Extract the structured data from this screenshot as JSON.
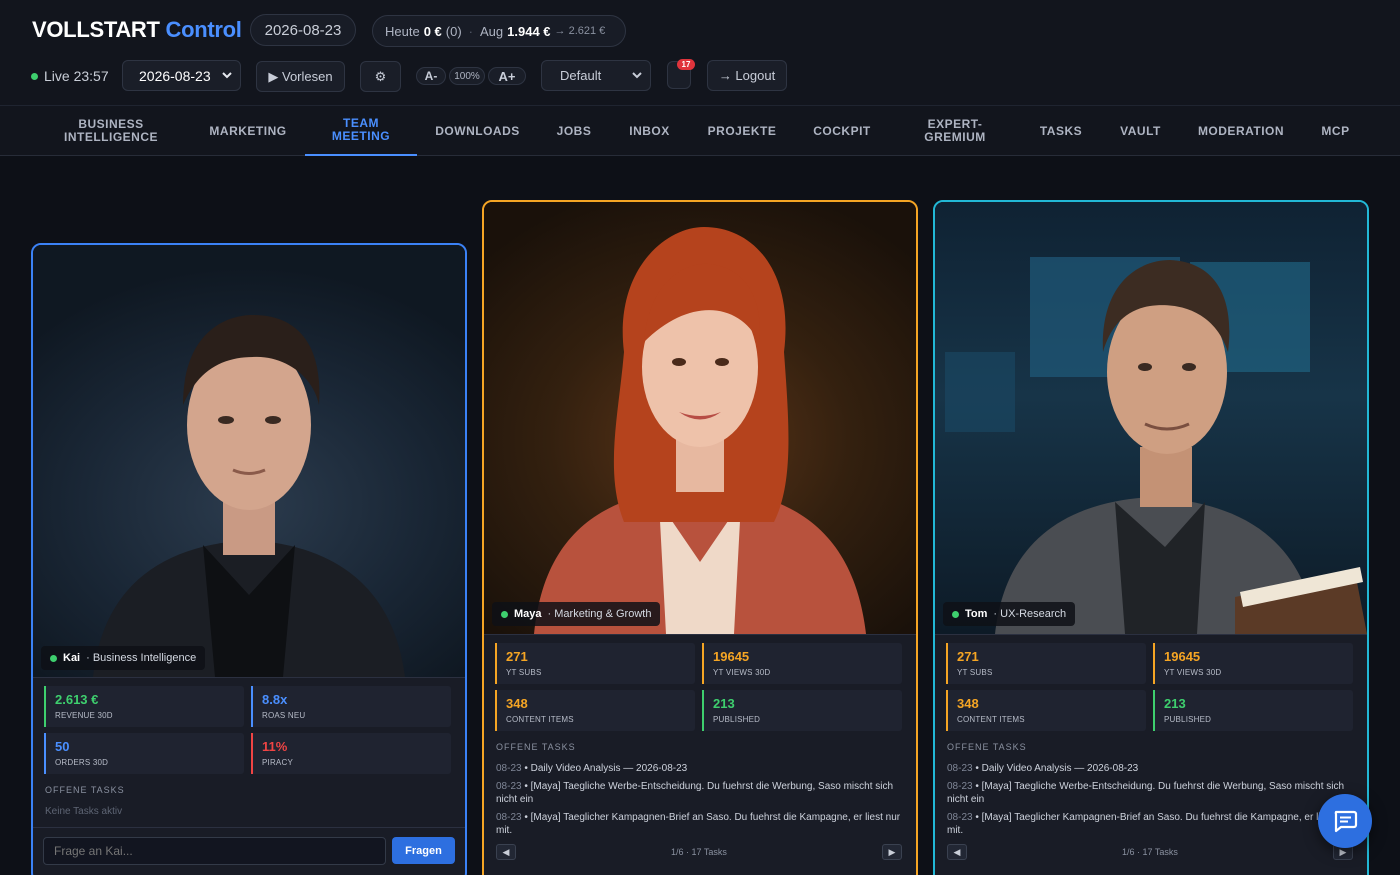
{
  "header": {
    "brand_main": "VOLLSTART",
    "brand_accent": "Control",
    "date_pill": "2026-08-23",
    "stats_pill": {
      "today_label": "Heute",
      "today_value": "0 €",
      "today_count": "(0)",
      "separator": "·",
      "month_label": "Aug",
      "month_value": "1.944 €",
      "forecast": "→ 2.621 €"
    },
    "live_label": "Live 23:57",
    "date_select": "2026-08-23",
    "read_button": "▶ Vorlesen",
    "settings_icon_glyph": "⚙",
    "font_minus": "A-",
    "zoom_level": "100%",
    "font_plus": "A+",
    "theme_select": "Default",
    "notification_count": "17",
    "notification_icon_glyph": "",
    "logout_button": "→ Logout"
  },
  "nav": {
    "items": [
      {
        "label": "BUSINESS INTELLIGENCE",
        "icon": ""
      },
      {
        "label": "MARKETING",
        "icon": ""
      },
      {
        "label": "TEAM MEETING",
        "icon": "",
        "active": true
      },
      {
        "label": "DOWNLOADS",
        "icon": ""
      },
      {
        "label": "JOBS",
        "icon": ""
      },
      {
        "label": "INBOX",
        "icon": ""
      },
      {
        "label": "PROJEKTE",
        "icon": ""
      },
      {
        "label": "COCKPIT",
        "icon": ""
      },
      {
        "label": "EXPERT-GREMIUM",
        "icon": ""
      },
      {
        "label": "TASKS",
        "icon": ""
      },
      {
        "label": "VAULT",
        "icon": ""
      },
      {
        "label": "MODERATION",
        "icon": ""
      },
      {
        "label": "MCP",
        "icon": ""
      }
    ]
  },
  "cards": [
    {
      "name": "Kai",
      "role": "· Business Intelligence",
      "border_color": "#3b82f6",
      "stats": [
        {
          "value": "2.613 €",
          "label": "REVENUE 30D",
          "color": "#3ecf6e"
        },
        {
          "value": "8.8x",
          "label": "ROAS NEU",
          "color": "#4a8fff"
        },
        {
          "value": "50",
          "label": "ORDERS 30D",
          "color": "#4a8fff"
        },
        {
          "value": "11%",
          "label": "PIRACY",
          "color": "#ef4444"
        }
      ],
      "tasks_title": "OFFENE TASKS",
      "empty_tasks": "Keine Tasks aktiv",
      "ask_placeholder": "Frage an Kai...",
      "ask_button": "Fragen"
    },
    {
      "name": "Maya",
      "role": "· Marketing & Growth",
      "border_color": "#f5a524",
      "stats": [
        {
          "value": "271",
          "label": "YT SUBS",
          "color": "#f5a524"
        },
        {
          "value": "19645",
          "label": "YT VIEWS 30D",
          "color": "#f5a524"
        },
        {
          "value": "348",
          "label": "CONTENT ITEMS",
          "color": "#f5a524"
        },
        {
          "value": "213",
          "label": "PUBLISHED",
          "color": "#3ecf6e"
        }
      ],
      "tasks_title": "OFFENE TASKS",
      "tasks": [
        {
          "date": "08-23",
          "text": "• Daily Video Analysis — 2026-08-23"
        },
        {
          "date": "08-23",
          "text": "• [Maya] Taegliche Werbe-Entscheidung. Du fuehrst die Werbung, Saso mischt sich nicht ein"
        },
        {
          "date": "08-23",
          "text": "• [Maya] Taeglicher Kampagnen-Brief an Saso. Du fuehrst die Kampagne, er liest nur mit."
        }
      ],
      "pager": "1/6 · 17 Tasks",
      "prev": "◀",
      "next": "▶"
    },
    {
      "name": "Tom",
      "role": "· UX-Research",
      "border_color": "#22b8d6",
      "stats": [
        {
          "value": "271",
          "label": "YT SUBS",
          "color": "#f5a524"
        },
        {
          "value": "19645",
          "label": "YT VIEWS 30D",
          "color": "#f5a524"
        },
        {
          "value": "348",
          "label": "CONTENT ITEMS",
          "color": "#f5a524"
        },
        {
          "value": "213",
          "label": "PUBLISHED",
          "color": "#3ecf6e"
        }
      ],
      "tasks_title": "OFFENE TASKS",
      "tasks": [
        {
          "date": "08-23",
          "text": "• Daily Video Analysis — 2026-08-23"
        },
        {
          "date": "08-23",
          "text": "• [Maya] Taegliche Werbe-Entscheidung. Du fuehrst die Werbung, Saso mischt sich nicht ein"
        },
        {
          "date": "08-23",
          "text": "• [Maya] Taeglicher Kampagnen-Brief an Saso. Du fuehrst die Kampagne, er liest nur mit."
        }
      ],
      "pager": "1/6 · 17 Tasks",
      "prev": "◀",
      "next": "▶"
    }
  ],
  "chat_fab_icon": "chat-bubble-icon"
}
